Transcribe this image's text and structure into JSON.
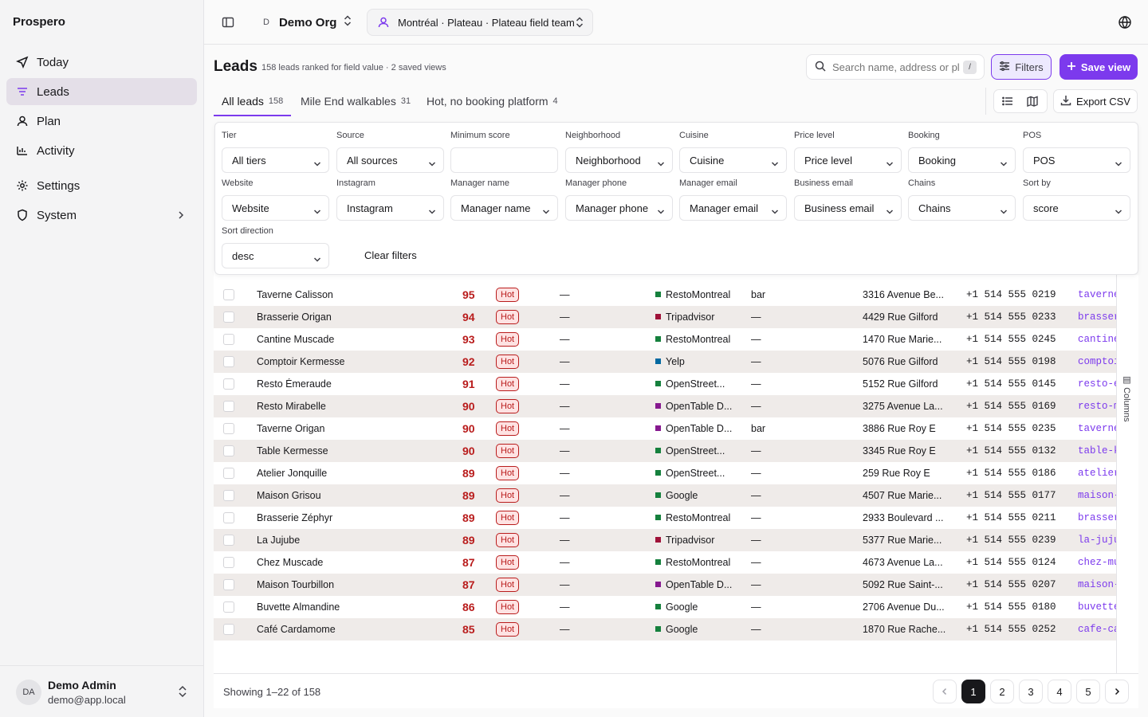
{
  "app": {
    "name": "Prospero"
  },
  "sidebar": {
    "items": [
      {
        "label": "Today",
        "icon": "send-icon"
      },
      {
        "label": "Leads",
        "icon": "list-filter-icon",
        "active": true
      },
      {
        "label": "Plan",
        "icon": "person-icon"
      },
      {
        "label": "Activity",
        "icon": "activity-icon"
      },
      {
        "label": "Settings",
        "icon": "gear-icon"
      },
      {
        "label": "System",
        "icon": "shield-icon"
      }
    ],
    "user": {
      "initials": "DA",
      "name": "Demo Admin",
      "email": "demo@app.local"
    }
  },
  "topbar": {
    "org_initial": "D",
    "org_name": "Demo Org",
    "location": "Montréal · Plateau · Plateau field team"
  },
  "page": {
    "title": "Leads",
    "subtitle": "158 leads ranked for field value · 2 saved views",
    "search_placeholder": "Search name, address or pl",
    "search_shortcut": "/",
    "filters_label": "Filters",
    "save_view_label": "Save view",
    "export_label": "Export CSV",
    "tabs": [
      {
        "label": "All leads",
        "count": "158"
      },
      {
        "label": "Mile End walkables",
        "count": "31"
      },
      {
        "label": "Hot, no booking platform",
        "count": "4"
      }
    ]
  },
  "filters": {
    "fields": [
      {
        "label": "Tier",
        "value": "All tiers"
      },
      {
        "label": "Source",
        "value": "All sources"
      },
      {
        "label": "Minimum score",
        "value": ""
      },
      {
        "label": "Neighborhood",
        "value": "Neighborhood"
      },
      {
        "label": "Cuisine",
        "value": "Cuisine"
      },
      {
        "label": "Price level",
        "value": "Price level"
      },
      {
        "label": "Booking",
        "value": "Booking"
      },
      {
        "label": "POS",
        "value": "POS"
      },
      {
        "label": "Website",
        "value": "Website"
      },
      {
        "label": "Instagram",
        "value": "Instagram"
      },
      {
        "label": "Manager name",
        "value": "Manager name"
      },
      {
        "label": "Manager phone",
        "value": "Manager phone"
      },
      {
        "label": "Manager email",
        "value": "Manager email"
      },
      {
        "label": "Business email",
        "value": "Business email"
      },
      {
        "label": "Chains",
        "value": "Chains"
      },
      {
        "label": "Sort by",
        "value": "score"
      },
      {
        "label": "Sort direction",
        "value": "desc"
      }
    ],
    "clear_label": "Clear filters"
  },
  "source_colors": {
    "RestoMontreal": "#15803d",
    "Tripadvisor": "#9f1239",
    "Yelp": "#0369a1",
    "OpenStreet...": "#15803d",
    "OpenTable D...": "#86198f",
    "Google": "#15803d"
  },
  "rows": [
    {
      "name": "Taverne Calisson",
      "score": "95",
      "tier": "Hot",
      "col": "—",
      "source": "RestoMontreal",
      "cuisine": "bar",
      "address": "3316 Avenue Be...",
      "phone": "+1 514 555 0219",
      "slug": "taverne-"
    },
    {
      "name": "Brasserie Origan",
      "score": "94",
      "tier": "Hot",
      "col": "—",
      "source": "Tripadvisor",
      "cuisine": "—",
      "address": "4429 Rue Gilford",
      "phone": "+1 514 555 0233",
      "slug": "brasseri"
    },
    {
      "name": "Cantine Muscade",
      "score": "93",
      "tier": "Hot",
      "col": "—",
      "source": "RestoMontreal",
      "cuisine": "—",
      "address": "1470 Rue Marie...",
      "phone": "+1 514 555 0245",
      "slug": "cantine-"
    },
    {
      "name": "Comptoir Kermesse",
      "score": "92",
      "tier": "Hot",
      "col": "—",
      "source": "Yelp",
      "cuisine": "—",
      "address": "5076 Rue Gilford",
      "phone": "+1 514 555 0198",
      "slug": "comptoi"
    },
    {
      "name": "Resto Émeraude",
      "score": "91",
      "tier": "Hot",
      "col": "—",
      "source": "OpenStreet...",
      "cuisine": "—",
      "address": "5152 Rue Gilford",
      "phone": "+1 514 555 0145",
      "slug": "resto-e-"
    },
    {
      "name": "Resto Mirabelle",
      "score": "90",
      "tier": "Hot",
      "col": "—",
      "source": "OpenTable D...",
      "cuisine": "—",
      "address": "3275 Avenue La...",
      "phone": "+1 514 555 0169",
      "slug": "resto-m"
    },
    {
      "name": "Taverne Origan",
      "score": "90",
      "tier": "Hot",
      "col": "—",
      "source": "OpenTable D...",
      "cuisine": "bar",
      "address": "3886 Rue Roy E",
      "phone": "+1 514 555 0235",
      "slug": "taverne-"
    },
    {
      "name": "Table Kermesse",
      "score": "90",
      "tier": "Hot",
      "col": "—",
      "source": "OpenStreet...",
      "cuisine": "—",
      "address": "3345 Rue Roy E",
      "phone": "+1 514 555 0132",
      "slug": "table-ke"
    },
    {
      "name": "Atelier Jonquille",
      "score": "89",
      "tier": "Hot",
      "col": "—",
      "source": "OpenStreet...",
      "cuisine": "—",
      "address": "259 Rue Roy E",
      "phone": "+1 514 555 0186",
      "slug": "atelier-j"
    },
    {
      "name": "Maison Grisou",
      "score": "89",
      "tier": "Hot",
      "col": "—",
      "source": "Google",
      "cuisine": "—",
      "address": "4507 Rue Marie...",
      "phone": "+1 514 555 0177",
      "slug": "maison-"
    },
    {
      "name": "Brasserie Zéphyr",
      "score": "89",
      "tier": "Hot",
      "col": "—",
      "source": "RestoMontreal",
      "cuisine": "—",
      "address": "2933 Boulevard ...",
      "phone": "+1 514 555 0211",
      "slug": "brasseri"
    },
    {
      "name": "La Jujube",
      "score": "89",
      "tier": "Hot",
      "col": "—",
      "source": "Tripadvisor",
      "cuisine": "—",
      "address": "5377 Rue Marie...",
      "phone": "+1 514 555 0239",
      "slug": "la-jujube"
    },
    {
      "name": "Chez Muscade",
      "score": "87",
      "tier": "Hot",
      "col": "—",
      "source": "RestoMontreal",
      "cuisine": "—",
      "address": "4673 Avenue La...",
      "phone": "+1 514 555 0124",
      "slug": "chez-mu"
    },
    {
      "name": "Maison Tourbillon",
      "score": "87",
      "tier": "Hot",
      "col": "—",
      "source": "OpenTable D...",
      "cuisine": "—",
      "address": "5092 Rue Saint-...",
      "phone": "+1 514 555 0207",
      "slug": "maison-"
    },
    {
      "name": "Buvette Almandine",
      "score": "86",
      "tier": "Hot",
      "col": "—",
      "source": "Google",
      "cuisine": "—",
      "address": "2706 Avenue Du...",
      "phone": "+1 514 555 0180",
      "slug": "buvette-"
    },
    {
      "name": "Café Cardamome",
      "score": "85",
      "tier": "Hot",
      "col": "—",
      "source": "Google",
      "cuisine": "—",
      "address": "1870 Rue Rache...",
      "phone": "+1 514 555 0252",
      "slug": "cafe-ca"
    }
  ],
  "columns_label": "Columns",
  "footer": {
    "showing": "Showing 1–22 of 158",
    "pages": [
      "1",
      "2",
      "3",
      "4",
      "5"
    ],
    "current_page": "1"
  }
}
